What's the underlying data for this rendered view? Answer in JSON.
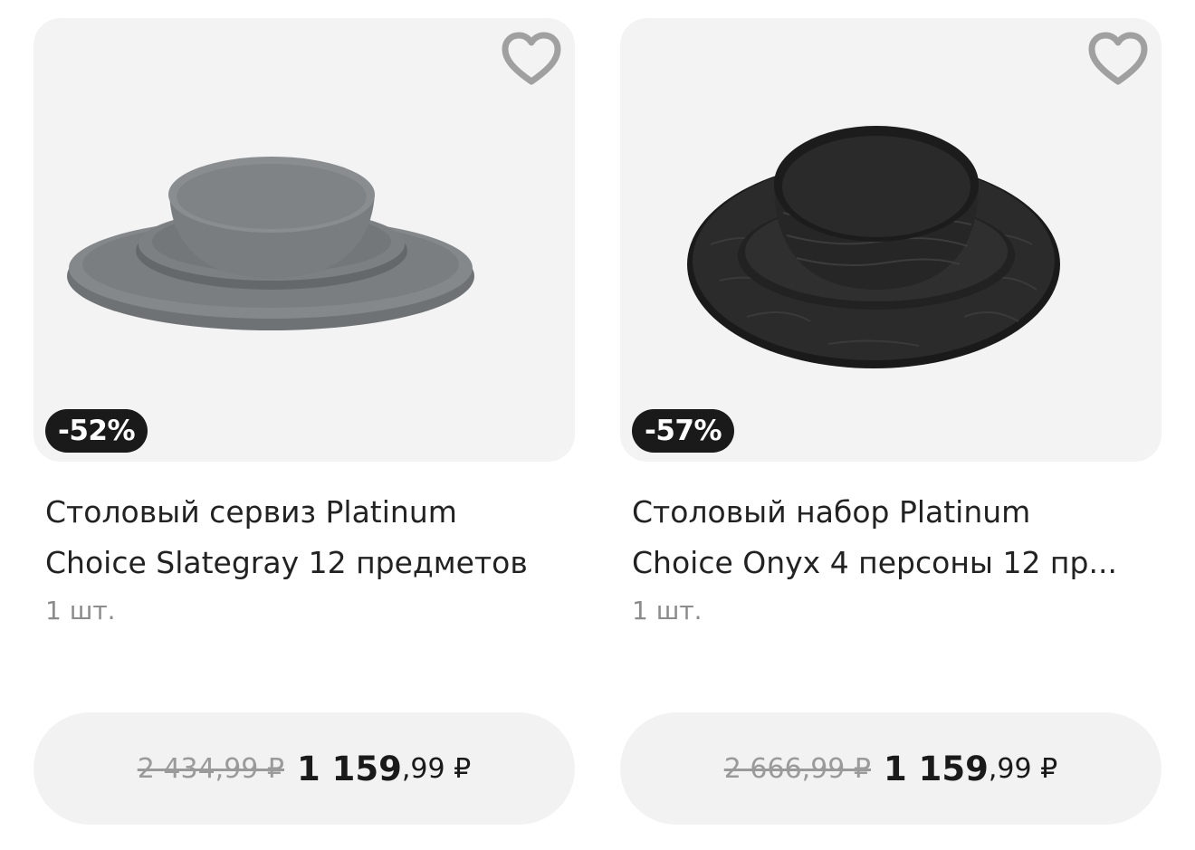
{
  "products": [
    {
      "discount": "-52%",
      "title_line1": "Столовый сервиз Platinum",
      "title_line2": "Choice Slategray 12 предметов",
      "quantity": "1 шт.",
      "old_price": "2 434,99 ₽",
      "new_price_int": "1 159",
      "new_price_frac": ",99 ₽",
      "image_icon": "gray-dinnerware-set-image"
    },
    {
      "discount": "-57%",
      "title_line1": "Столовый набор Platinum",
      "title_line2": "Choice Onyx 4 персоны 12 пр...",
      "quantity": "1 шт.",
      "old_price": "2 666,99 ₽",
      "new_price_int": "1 159",
      "new_price_frac": ",99 ₽",
      "image_icon": "black-dinnerware-set-image"
    }
  ],
  "colors": {
    "card_bg": "#f3f3f3",
    "badge_bg": "#1a1a1a",
    "price_button_bg": "#f2f2f2",
    "heart_stroke": "#a0a0a0"
  }
}
